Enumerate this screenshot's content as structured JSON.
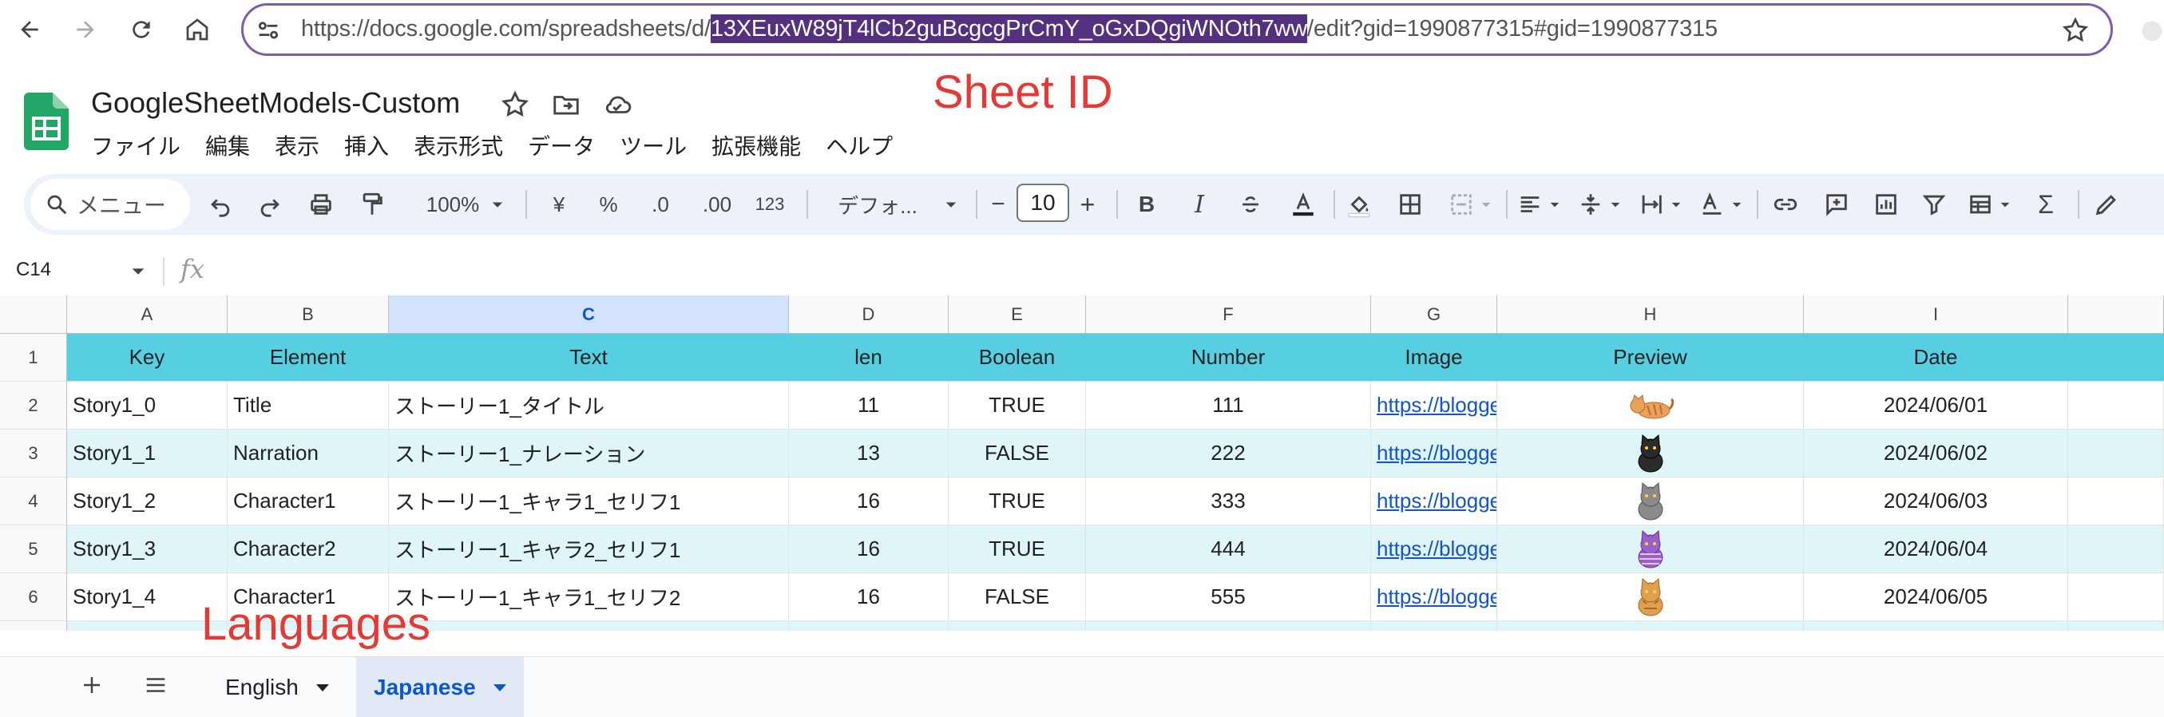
{
  "browser": {
    "url_prefix": "https://docs.google.com/spreadsheets/d/",
    "url_selected": "13XEuxW89jT4lCb2guBcgcgPrCmY_oGxDQgiWNOth7ww",
    "url_suffix": "/edit?gid=1990877315#gid=1990877315"
  },
  "doc": {
    "title": "GoogleSheetModels-Custom",
    "menus": [
      "ファイル",
      "編集",
      "表示",
      "挿入",
      "表示形式",
      "データ",
      "ツール",
      "拡張機能",
      "ヘルプ"
    ]
  },
  "annotations": {
    "sheet_id": "Sheet ID",
    "languages": "Languages"
  },
  "toolbar": {
    "search_menus": "メニュー",
    "zoom": "100%",
    "currency": "¥",
    "percent": "%",
    "dec_decrease": ".0",
    "dec_increase": ".00",
    "more_formats": "123",
    "font": "デフォ...",
    "font_size": "10",
    "minus": "−",
    "plus": "+",
    "bold": "B",
    "italic": "I",
    "sigma": "Σ"
  },
  "formula_bar": {
    "name_box": "C14",
    "fx": "fx"
  },
  "grid": {
    "columns": [
      "A",
      "B",
      "C",
      "D",
      "E",
      "F",
      "G",
      "H",
      "I"
    ],
    "selected_column": "C",
    "row_numbers": [
      "1",
      "2",
      "3",
      "4",
      "5",
      "6"
    ],
    "header_row": [
      "Key",
      "Element",
      "Text",
      "len",
      "Boolean",
      "Number",
      "Image",
      "Preview",
      "Date"
    ],
    "rows": [
      {
        "key": "Story1_0",
        "element": "Title",
        "text": "ストーリー1_タイトル",
        "len": "11",
        "boolean": "TRUE",
        "number": "111",
        "image": "https://blogger",
        "preview": "cat-orange-lying",
        "date": "2024/06/01"
      },
      {
        "key": "Story1_1",
        "element": "Narration",
        "text": "ストーリー1_ナレーション",
        "len": "13",
        "boolean": "FALSE",
        "number": "222",
        "image": "https://blogger",
        "preview": "cat-black",
        "date": "2024/06/02"
      },
      {
        "key": "Story1_2",
        "element": "Character1",
        "text": "ストーリー1_キャラ1_セリフ1",
        "len": "16",
        "boolean": "TRUE",
        "number": "333",
        "image": "https://blogger",
        "preview": "cat-gray",
        "date": "2024/06/03"
      },
      {
        "key": "Story1_3",
        "element": "Character2",
        "text": "ストーリー1_キャラ2_セリフ1",
        "len": "16",
        "boolean": "TRUE",
        "number": "444",
        "image": "https://blogger",
        "preview": "cat-purple-striped",
        "date": "2024/06/04"
      },
      {
        "key": "Story1_4",
        "element": "Character1",
        "text": "ストーリー1_キャラ1_セリフ2",
        "len": "16",
        "boolean": "FALSE",
        "number": "555",
        "image": "https://blogger",
        "preview": "cat-orange-sitting",
        "date": "2024/06/05"
      }
    ],
    "colors": {
      "header_bg": "#56d0e0",
      "alt_row_bg": "#dff5f8",
      "link": "#1155cc"
    }
  },
  "tabs": [
    {
      "label": "English",
      "active": false
    },
    {
      "label": "Japanese",
      "active": true
    }
  ]
}
